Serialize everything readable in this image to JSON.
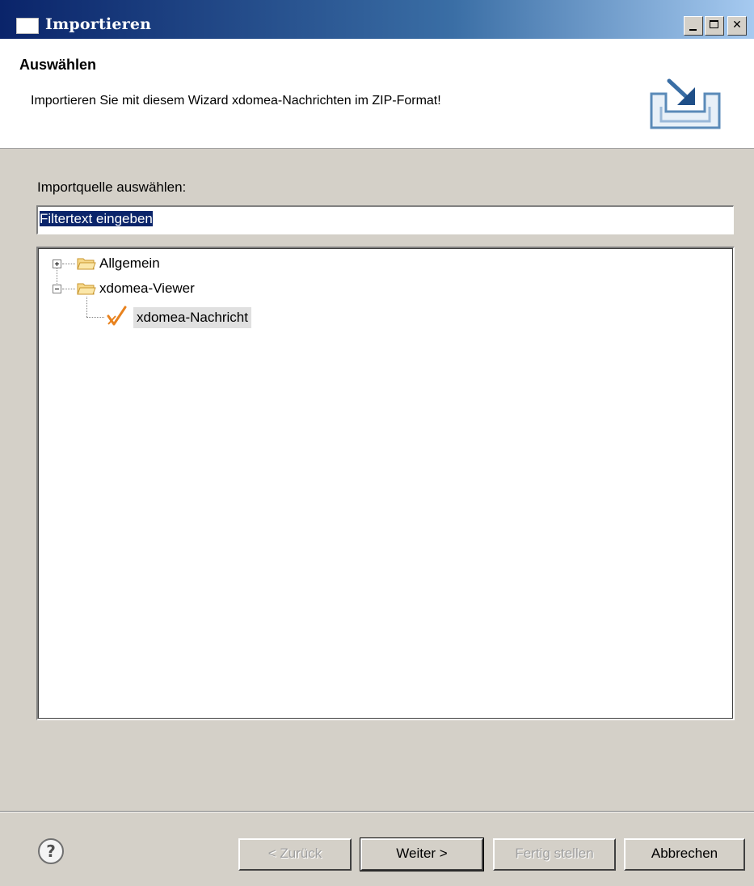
{
  "window": {
    "title": "Importieren"
  },
  "banner": {
    "heading": "Auswählen",
    "description": "Importieren Sie mit diesem Wizard xdomea-Nachrichten im ZIP-Format!",
    "icon": "import-wizard-icon"
  },
  "main": {
    "source_label": "Importquelle auswählen:",
    "filter": {
      "value": "Filtertext eingeben",
      "selected": true
    },
    "tree": [
      {
        "label": "Allgemein",
        "icon": "folder-icon",
        "expanded": false
      },
      {
        "label": "xdomea-Viewer",
        "icon": "folder-icon",
        "expanded": true,
        "children": [
          {
            "label": "xdomea-Nachricht",
            "icon": "checkmark-icon",
            "selected": true
          }
        ]
      }
    ]
  },
  "footer": {
    "help_icon": "help-icon",
    "back_label": "< Zurück",
    "next_label": "Weiter >",
    "finish_label": "Fertig stellen",
    "cancel_label": "Abbrechen"
  },
  "colors": {
    "title_bar": "#0a246a",
    "selection": "#0a246a",
    "dialog_bg": "#d4d0c8"
  }
}
